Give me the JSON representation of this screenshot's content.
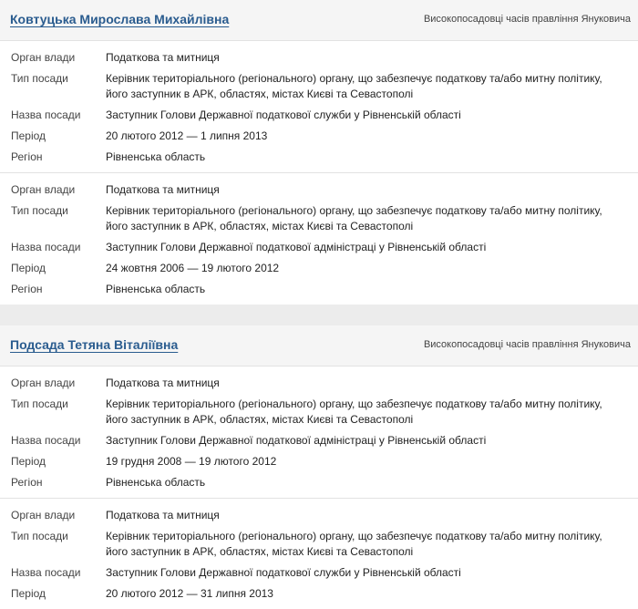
{
  "labels": {
    "organ": "Орган влади",
    "type": "Тип посади",
    "position": "Назва посади",
    "period": "Період",
    "region": "Регіон"
  },
  "persons": [
    {
      "name": "Ковтуцька Мирослава Михайлівна",
      "category": "Високопосадовці часів правління Януковича",
      "records": [
        {
          "organ": "Податкова та митниця",
          "type": "Керівник територіального (регіонального) органу, що забезпечує податкову та/або митну політику, його заступник в АРК, областях, містах Києві та Севастополі",
          "position": "Заступник Голови Державної податкової служби у Рівненській області",
          "period": "20 лютого 2012 — 1 липня 2013",
          "region": "Рівненська область"
        },
        {
          "organ": "Податкова та митниця",
          "type": "Керівник територіального (регіонального) органу, що забезпечує податкову та/або митну політику, його заступник в АРК, областях, містах Києві та Севастополі",
          "position": "Заступник Голови Державної податкової адміністраці у Рівненській області",
          "period": "24 жовтня 2006 — 19 лютого 2012",
          "region": "Рівненська область"
        }
      ]
    },
    {
      "name": "Подсада Тетяна Віталіївна",
      "category": "Високопосадовці часів правління Януковича",
      "records": [
        {
          "organ": "Податкова та митниця",
          "type": "Керівник територіального (регіонального) органу, що забезпечує податкову та/або митну політику, його заступник в АРК, областях, містах Києві та Севастополі",
          "position": "Заступник Голови Державної податкової адміністраці у Рівненській області",
          "period": "19 грудня 2008 — 19 лютого 2012",
          "region": "Рівненська область"
        },
        {
          "organ": "Податкова та митниця",
          "type": "Керівник територіального (регіонального) органу, що забезпечує податкову та/або митну політику, його заступник в АРК, областях, містах Києві та Севастополі",
          "position": "Заступник Голови Державної податкової служби у Рівненській області",
          "period": "20 лютого 2012 — 31 липня 2013"
        }
      ]
    }
  ]
}
